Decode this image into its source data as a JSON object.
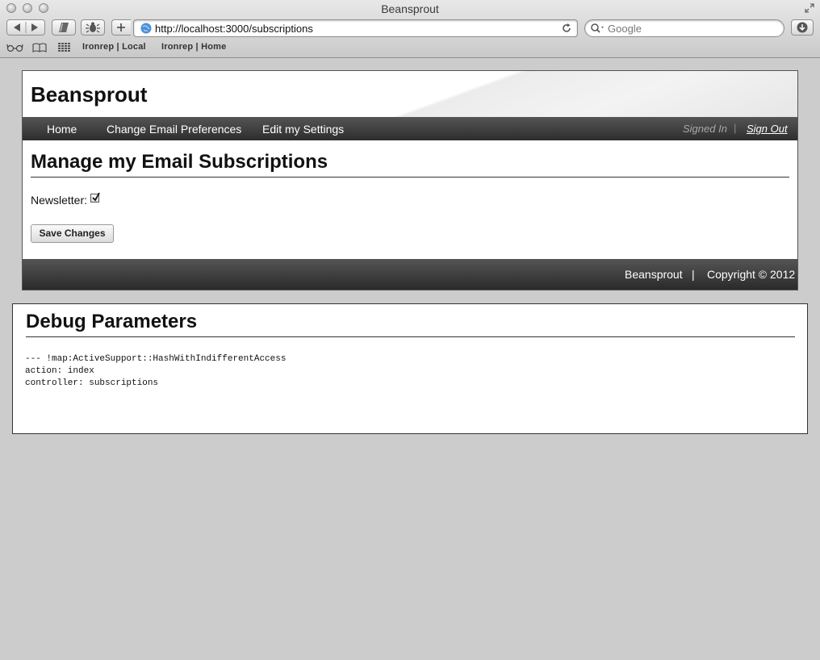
{
  "window": {
    "title": "Beansprout"
  },
  "browser": {
    "url": "http://localhost:3000/subscriptions",
    "search_placeholder": "Google",
    "bookmarks": [
      "Ironrep | Local",
      "Ironrep | Home"
    ]
  },
  "site": {
    "title": "Beansprout",
    "nav": {
      "links": [
        "Home",
        "Change Email Preferences",
        "Edit my Settings"
      ],
      "signed_in": "Signed In",
      "separator": "|",
      "sign_out": "Sign Out"
    },
    "page_title": "Manage my Email Subscriptions",
    "form": {
      "newsletter_label": "Newsletter:",
      "newsletter_checked": true,
      "save_label": "Save Changes"
    },
    "footer": {
      "brand": "Beansprout",
      "separator": "|",
      "copyright": "Copyright © 2012"
    }
  },
  "debug": {
    "title": "Debug Parameters",
    "lines": [
      "--- !map:ActiveSupport::HashWithIndifferentAccess",
      "action: index",
      "controller: subscriptions"
    ]
  }
}
